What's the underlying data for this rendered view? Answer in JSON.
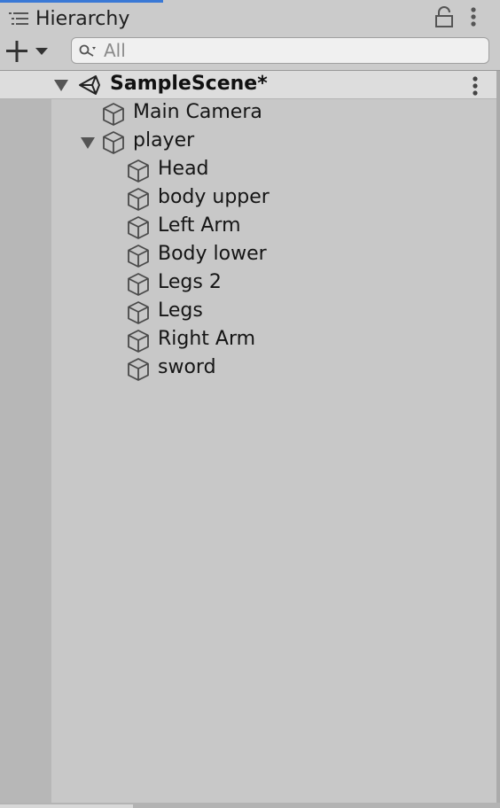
{
  "panel": {
    "tab_title": "Hierarchy",
    "tab_icon": "list-icon",
    "lock_icon": "lock-icon",
    "menu_icon": "kebab-menu-icon"
  },
  "toolbar": {
    "add_icon": "plus-icon",
    "dropdown_icon": "chevron-down-icon",
    "search": {
      "placeholder": "All",
      "value": ""
    }
  },
  "scene": {
    "title": "SampleScene*",
    "icon": "unity-icon",
    "expanded": true
  },
  "tree": {
    "main_camera": "Main Camera",
    "player": {
      "label": "player",
      "expanded": true,
      "children": [
        "Head",
        "body upper",
        "Left Arm",
        "Body lower",
        "Legs 2",
        "Legs",
        "Right Arm",
        "sword"
      ]
    }
  },
  "colors": {
    "accent": "#3a79d6",
    "panel_bg": "#c8c8c8",
    "header_bg": "#dddddd"
  }
}
